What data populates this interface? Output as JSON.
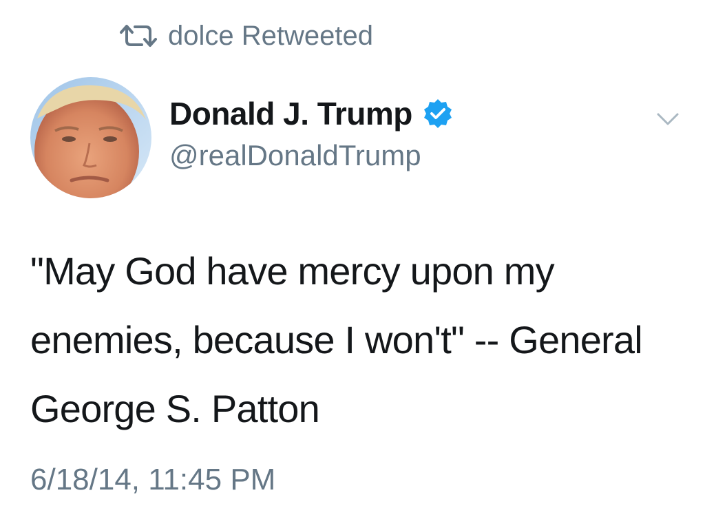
{
  "retweet": {
    "icon": "retweet-icon",
    "text": "dolce Retweeted"
  },
  "author": {
    "display_name": "Donald J. Trump",
    "handle": "@realDonaldTrump",
    "verified_icon": "verified-badge-icon",
    "avatar": "profile-photo"
  },
  "tweet": {
    "text": "\"May God have mercy upon my enemies, because I won't\" -- General George S. Patton",
    "timestamp": "6/18/14, 11:45 PM"
  },
  "menu": {
    "icon": "chevron-down-icon"
  },
  "colors": {
    "text_primary": "#14171a",
    "text_secondary": "#657786",
    "verified_blue": "#1da1f2"
  }
}
